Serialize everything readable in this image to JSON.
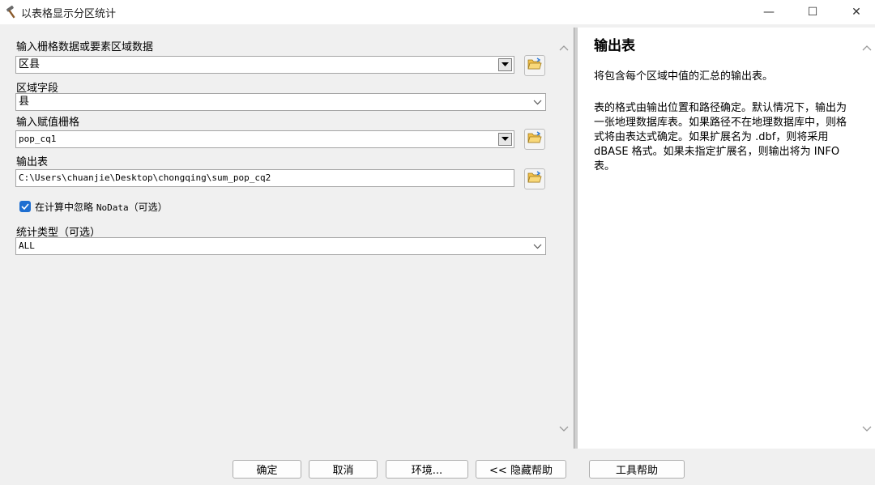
{
  "window": {
    "title": "以表格显示分区统计",
    "minimize_glyph": "—",
    "maximize_glyph": "☐",
    "close_glyph": "✕"
  },
  "form": {
    "zone_data": {
      "label": "输入栅格数据或要素区域数据",
      "value": "区县"
    },
    "zone_field": {
      "label": "区域字段",
      "value": "县"
    },
    "value_raster": {
      "label": "输入赋值栅格",
      "value": "pop_cq1"
    },
    "output_table": {
      "label": "输出表",
      "value": "C:\\Users\\chuanjie\\Desktop\\chongqing\\sum_pop_cq2"
    },
    "ignore_nodata": {
      "label_prefix": "在计算中忽略 ",
      "label_mono": "NoData",
      "label_suffix": "（可选）",
      "checked": true
    },
    "statistics_type": {
      "label": "统计类型（可选）",
      "value": "ALL"
    }
  },
  "help": {
    "title": "输出表",
    "p1": "将包含每个区域中值的汇总的输出表。",
    "p2": "表的格式由输出位置和路径确定。默认情况下，输出为一张地理数据库表。如果路径不在地理数据库中，则格式将由表达式确定。如果扩展名为 .dbf，则将采用 dBASE 格式。如果未指定扩展名，则输出将为 INFO 表。"
  },
  "buttons": {
    "ok": "确定",
    "cancel": "取消",
    "environments": "环境...",
    "hide_help": "<< 隐藏帮助",
    "tool_help": "工具帮助"
  },
  "icons": {
    "app": "hammer-icon",
    "browse": "folder-open-icon",
    "dropdown": "dropdown-arrow-icon",
    "chevron": "chevron-down-icon",
    "scroll_up": "chevron-up-icon",
    "scroll_down": "chevron-down-icon"
  },
  "colors": {
    "accent": "#1f6fd1",
    "folder": "#f2c04a"
  }
}
